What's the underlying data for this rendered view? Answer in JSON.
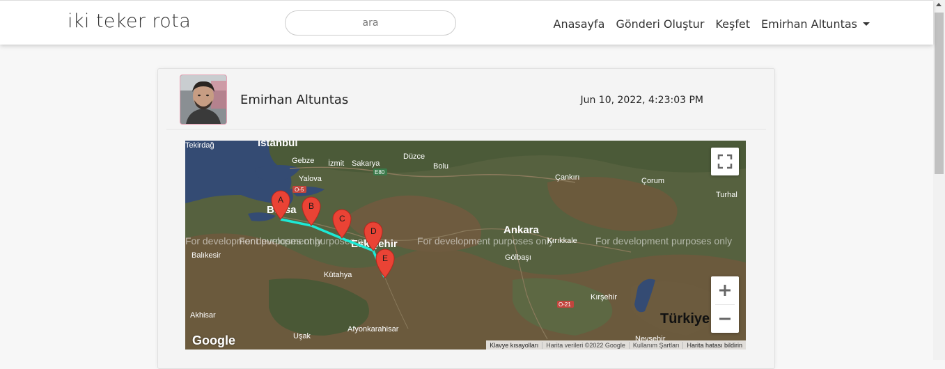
{
  "navbar": {
    "brand": "iki teker rota",
    "search_placeholder": "ara",
    "links": [
      "Anasayfa",
      "Gönderi Oluştur",
      "Keşfet",
      "Emirhan Altuntas"
    ]
  },
  "post": {
    "author": "Emirhan Altuntas",
    "timestamp": "Jun 10, 2022, 4:23:03 PM",
    "map": {
      "watermark": "For development purposes only",
      "markers": [
        "A",
        "B",
        "C",
        "D",
        "E"
      ],
      "route_color": "#1de9d6",
      "marker_color": "#ea4335",
      "cities": [
        "Tekirdağ",
        "İstanbul",
        "Gebze",
        "İzmit",
        "Sakarya",
        "Düzce",
        "Bolu",
        "Yalova",
        "Bursa",
        "Eskişehir",
        "Ankara",
        "Kırıkkale",
        "Gölbaşı",
        "Çankırı",
        "Çorum",
        "Turhal",
        "Balıkesir",
        "Kütahya",
        "Akhisar",
        "Afyonkarahisar",
        "Uşak",
        "Kırşehir",
        "Nevşehir",
        "Türkiye"
      ],
      "road_labels": [
        "O-5",
        "E80",
        "O-21"
      ],
      "google": "Google",
      "attribution": [
        "Klavye kısayolları",
        "Harita verileri ©2022 Google",
        "Kullanım Şartları",
        "Harita hatası bildirin"
      ]
    }
  }
}
